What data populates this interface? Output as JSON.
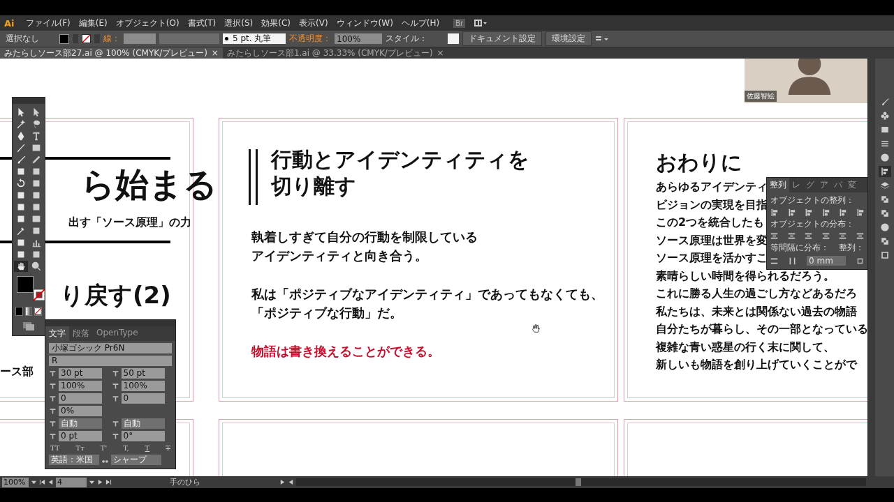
{
  "app_logo": "Ai",
  "menu": [
    "ファイル(F)",
    "編集(E)",
    "オブジェクト(O)",
    "書式(T)",
    "選択(S)",
    "効果(C)",
    "表示(V)",
    "ウィンドウ(W)",
    "ヘルプ(H)"
  ],
  "bridge_button": "Br",
  "control_bar": {
    "selection": "選択なし",
    "stroke_label": "線：",
    "stroke_profile": "5 pt. 丸筆",
    "opacity_label": "不透明度：",
    "opacity": "100%",
    "style_label": "スタイル：",
    "buttons": [
      "ドキュメント設定",
      "環境設定"
    ]
  },
  "doc_tabs": [
    {
      "label": "みたらしソース部27.ai @ 100% (CMYK/プレビュー)",
      "close": "×",
      "selected": true
    },
    {
      "label": "みたらしソース部1.ai @ 33.33% (CMYK/プレビュー)",
      "close": "×",
      "selected": false
    }
  ],
  "left_artboard": {
    "heading": "ら始まる",
    "subtitle": "出す「ソース原理」の力",
    "heading_2": "り戻す(2)",
    "footer": "ース部"
  },
  "middle_artboard": {
    "title": [
      "行動とアイデンティティを",
      "切り離す"
    ],
    "paragraphs": [
      {
        "kind": "body",
        "lines": [
          "執着しすぎて自分の行動を制限している",
          "アイデンティティと向き合う。"
        ]
      },
      {
        "kind": "body",
        "lines": [
          "私は「ポジティブなアイデンティティ」であってもなくても、",
          "「ポジティブな行動」だ。"
        ]
      },
      {
        "kind": "emphasis",
        "lines": [
          "物語は書き換えることができる。"
        ]
      }
    ]
  },
  "right_artboard": {
    "title": "おわりに",
    "lines": [
      "あらゆるアイデンティ",
      "ビジョンの実現を目指",
      "この2つを統合したも",
      "ソース原理は世界を変",
      "ソース原理を活かすこ",
      "素晴らしい時間を得られるだろう。",
      "これに勝る人生の過ごし方などあるだろ",
      "私たちは、未来とは関係ない過去の物語",
      "自分たちが暮らし、その一部となっている",
      "複雑な青い惑星の行く末に関して、",
      "新しいも物語を創り上げていくことがで"
    ]
  },
  "tools": [
    {
      "kind": "arrow",
      "selected": false
    },
    {
      "kind": "arrow",
      "selected": false
    },
    {
      "kind": "wand",
      "selected": false
    },
    {
      "kind": "lasso",
      "selected": false
    },
    {
      "kind": "pen",
      "selected": false
    },
    {
      "kind": "type",
      "selected": false
    },
    {
      "kind": "line",
      "selected": false
    },
    {
      "kind": "rectangle",
      "selected": false
    },
    {
      "kind": "brush",
      "selected": false
    },
    {
      "kind": "pencil",
      "selected": false
    },
    {
      "kind": "blob-brush",
      "selected": false
    },
    {
      "kind": "eraser",
      "selected": false
    },
    {
      "kind": "rotate",
      "selected": false
    },
    {
      "kind": "scale",
      "selected": false
    },
    {
      "kind": "warp",
      "selected": false
    },
    {
      "kind": "transform",
      "selected": false
    },
    {
      "kind": "shape-builder",
      "selected": false
    },
    {
      "kind": "grid",
      "selected": false
    },
    {
      "kind": "mesh",
      "selected": false
    },
    {
      "kind": "gradient",
      "selected": false
    },
    {
      "kind": "eyedropper",
      "selected": false
    },
    {
      "kind": "blend",
      "selected": false
    },
    {
      "kind": "sprayer",
      "selected": false
    },
    {
      "kind": "graph",
      "selected": false
    },
    {
      "kind": "artboard",
      "selected": false
    },
    {
      "kind": "knife",
      "selected": false
    },
    {
      "kind": "hand",
      "selected": true
    },
    {
      "kind": "zoom",
      "selected": false
    }
  ],
  "dock": [
    {
      "kind": "brush",
      "selected": false
    },
    {
      "kind": "club",
      "selected": false
    },
    {
      "kind": "gradient",
      "selected": false
    },
    {
      "kind": "lines",
      "selected": false
    },
    {
      "kind": "circle",
      "selected": false
    },
    {
      "kind": "align",
      "selected": true
    },
    {
      "kind": "layers",
      "selected": false
    },
    {
      "kind": "squares",
      "selected": false
    },
    {
      "kind": "squares",
      "selected": false
    },
    {
      "kind": "circle",
      "selected": false
    },
    {
      "kind": "squares",
      "selected": false
    },
    {
      "kind": "frame",
      "selected": false
    }
  ],
  "character_panel": {
    "tabs": [
      {
        "label": "文字",
        "selected": true
      },
      {
        "label": "段落",
        "selected": false
      },
      {
        "label": "OpenType",
        "selected": false
      }
    ],
    "font_family": "小塚ゴシック Pr6N",
    "font_style": "R",
    "rows": [
      [
        {
          "kind": "spin",
          "value": "30 pt"
        },
        {
          "kind": "spin",
          "value": "50 pt"
        }
      ],
      [
        {
          "kind": "spin",
          "value": "100%"
        },
        {
          "kind": "spin",
          "value": "100%"
        }
      ],
      [
        {
          "kind": "spin",
          "value": "0"
        },
        {
          "kind": "spin",
          "value": "0"
        }
      ],
      [
        {
          "kind": "spin",
          "value": "0%"
        }
      ],
      [
        {
          "kind": "select",
          "value": "自動"
        },
        {
          "kind": "select",
          "value": "自動"
        }
      ],
      [
        {
          "kind": "spin",
          "value": "0 pt"
        },
        {
          "kind": "spin",
          "value": "0°"
        }
      ]
    ],
    "style_buttons": [
      {
        "kind": "plain",
        "label": "TT"
      },
      {
        "kind": "small",
        "label": "Tт"
      },
      {
        "kind": "sup",
        "label": "T'"
      },
      {
        "kind": "sub",
        "label": "T,"
      },
      {
        "kind": "underline",
        "label": "T"
      },
      {
        "kind": "strike",
        "label": "T"
      }
    ],
    "language": "英語：米国",
    "antialias": "シャープ"
  },
  "align_panel": {
    "tabs": [
      {
        "label": "整列",
        "selected": true
      },
      {
        "label": "レ",
        "selected": false
      },
      {
        "label": "グ",
        "selected": false
      },
      {
        "label": "ア",
        "selected": false
      },
      {
        "label": "パ",
        "selected": false
      },
      {
        "label": "変",
        "selected": false
      }
    ],
    "align_label": "オブジェクトの整列：",
    "distribute_label": "オブジェクトの分布：",
    "spacing_label": "等間隔に分布：",
    "align_to_label": "整列：",
    "spacing_value": "0 mm"
  },
  "status_bar": {
    "zoom": "100%",
    "page": "4",
    "tool": "手のひら"
  },
  "webcam": {
    "name": "佐藤智絵"
  }
}
